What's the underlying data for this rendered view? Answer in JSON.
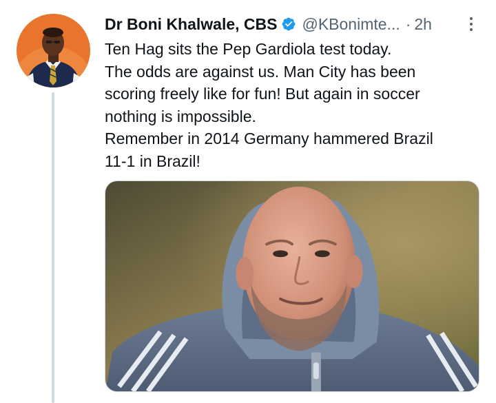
{
  "tweet": {
    "author": {
      "display_name": "Dr Boni Khalwale, CBS",
      "handle": "@KBonimte...",
      "verified": true,
      "verified_icon": "verified-badge-icon",
      "avatar_icon": "profile-photo"
    },
    "separator": "·",
    "timestamp": "2h",
    "more_icon": "more-vertical-icon",
    "text_lines": [
      "Ten Hag sits the Pep Gardiola test today.",
      "The odds are against us. Man City has been",
      "scoring freely like for fun! But again in soccer",
      "nothing is impossible.",
      "Remember in 2014 Germany hammered Brazil",
      "11-1 in Brazil!"
    ],
    "media": {
      "kind": "photo",
      "subject_icon": "man-in-grey-hoodie-photo"
    }
  },
  "colors": {
    "text_primary": "#0f1419",
    "text_secondary": "#536471",
    "verified_blue": "#1d9bf0",
    "thread_line": "#cfd9de",
    "avatar_bg": "#e8742e"
  }
}
